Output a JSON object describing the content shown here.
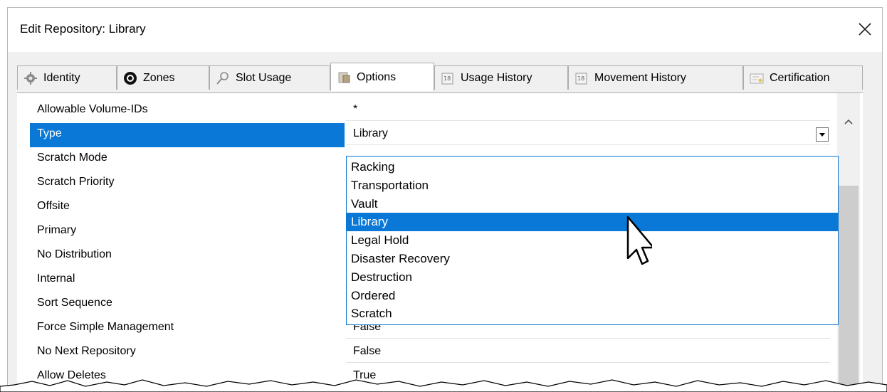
{
  "window": {
    "title": "Edit Repository: Library"
  },
  "tabs": [
    {
      "label": "Identity",
      "icon": "gear-icon"
    },
    {
      "label": "Zones",
      "icon": "at-sign-icon"
    },
    {
      "label": "Slot Usage",
      "icon": "magnifier-icon"
    },
    {
      "label": "Options",
      "icon": "options-icon",
      "active": true
    },
    {
      "label": "Usage History",
      "icon": "calendar-icon"
    },
    {
      "label": "Movement History",
      "icon": "calendar-icon"
    },
    {
      "label": "Certification",
      "icon": "certificate-icon"
    }
  ],
  "properties": [
    {
      "name": "Allowable Volume-IDs",
      "value": "*"
    },
    {
      "name": "Type",
      "value": "Library",
      "selected": true
    },
    {
      "name": "Scratch Mode",
      "value": ""
    },
    {
      "name": "Scratch Priority",
      "value": ""
    },
    {
      "name": "Offsite",
      "value": ""
    },
    {
      "name": "Primary",
      "value": ""
    },
    {
      "name": "No Distribution",
      "value": ""
    },
    {
      "name": "Internal",
      "value": ""
    },
    {
      "name": "Sort Sequence",
      "value": ""
    },
    {
      "name": "Force Simple Management",
      "value": "False"
    },
    {
      "name": "No Next Repository",
      "value": "False"
    },
    {
      "name": "Allow Deletes",
      "value": "True"
    }
  ],
  "type_dropdown": {
    "options": [
      "Racking",
      "Transportation",
      "Vault",
      "Library",
      "Legal Hold",
      "Disaster Recovery",
      "Destruction",
      "Ordered",
      "Scratch"
    ],
    "selected": "Library"
  },
  "colors": {
    "selection": "#0a78d7",
    "dialog_bg": "#f0f0f0"
  }
}
